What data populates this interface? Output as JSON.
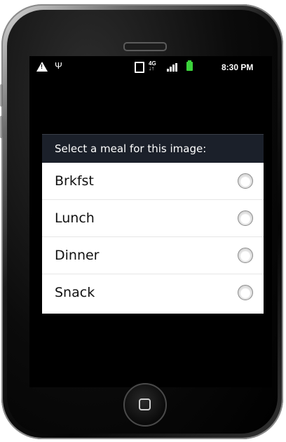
{
  "statusbar": {
    "network_label": "4G",
    "time": "8:30 PM",
    "icons": [
      "warning-icon",
      "usb-icon",
      "vibrate-icon",
      "network-icon",
      "signal-icon",
      "battery-charging-icon"
    ]
  },
  "dialog": {
    "title": "Select a meal for this image:",
    "options": [
      {
        "label": "Brkfst",
        "selected": false
      },
      {
        "label": "Lunch",
        "selected": false
      },
      {
        "label": "Dinner",
        "selected": false
      },
      {
        "label": "Snack",
        "selected": false
      }
    ]
  },
  "colors": {
    "dialog_header_bg": "#1b202a",
    "battery": "#3bd33b"
  }
}
